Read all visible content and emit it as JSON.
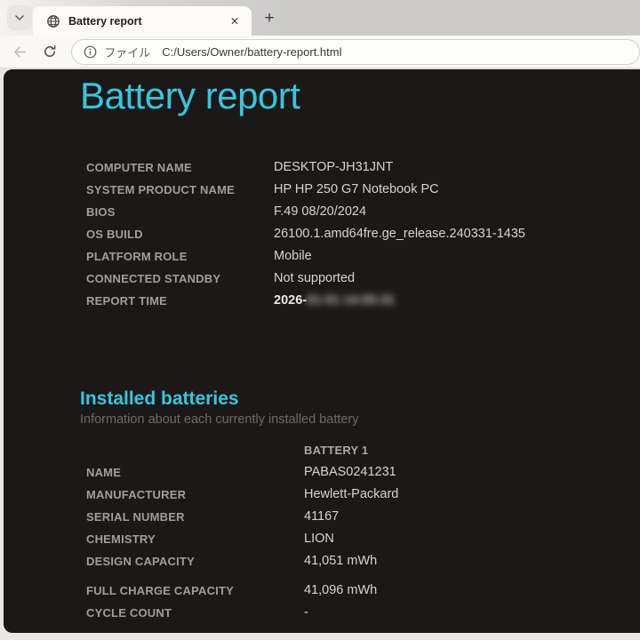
{
  "colors": {
    "accent_cyan": "#38c5dd",
    "page_background": "#1a1918",
    "tab_strip_gray": "#cccbca",
    "label_gray": "#a29e97",
    "value_gray": "#d7d4cf"
  },
  "browser": {
    "tab_strip": {
      "tab_search_icon": "chevron-down-icon",
      "new_tab_label": "+"
    },
    "tab": {
      "favicon": "globe-icon",
      "title": "Battery report",
      "close_label": "✕"
    },
    "toolbar": {
      "back_icon": "back-arrow-icon",
      "refresh_icon": "refresh-icon"
    },
    "address_bar": {
      "info_icon": "info-icon",
      "scheme_label": "ファイル",
      "url": "C:/Users/Owner/battery-report.html"
    }
  },
  "page": {
    "title": "Battery report",
    "system": {
      "rows": [
        {
          "label": "COMPUTER NAME",
          "value": "DESKTOP-JH31JNT"
        },
        {
          "label": "SYSTEM PRODUCT NAME",
          "value": "HP HP 250 G7 Notebook PC"
        },
        {
          "label": "BIOS",
          "value": "F.49 08/20/2024"
        },
        {
          "label": "OS BUILD",
          "value": "26100.1.amd64fre.ge_release.240331-1435"
        },
        {
          "label": "PLATFORM ROLE",
          "value": "Mobile"
        },
        {
          "label": "CONNECTED STANDBY",
          "value": "Not supported"
        }
      ],
      "report_time": {
        "label": "REPORT TIME",
        "visible_prefix": "2026-",
        "redacted_text": "01-01 14:05:31"
      }
    },
    "installed_batteries": {
      "heading": "Installed batteries",
      "subtitle": "Information about each currently installed battery",
      "column_header": "BATTERY 1",
      "rows": [
        {
          "label": "NAME",
          "value": "PABAS0241231"
        },
        {
          "label": "MANUFACTURER",
          "value": "Hewlett-Packard"
        },
        {
          "label": "SERIAL NUMBER",
          "value": "41167"
        },
        {
          "label": "CHEMISTRY",
          "value": "LION"
        },
        {
          "label": "DESIGN CAPACITY",
          "value": "41,051 mWh"
        },
        {
          "label": "FULL CHARGE CAPACITY",
          "value": "41,096 mWh"
        },
        {
          "label": "CYCLE COUNT",
          "value": "-"
        }
      ]
    }
  }
}
